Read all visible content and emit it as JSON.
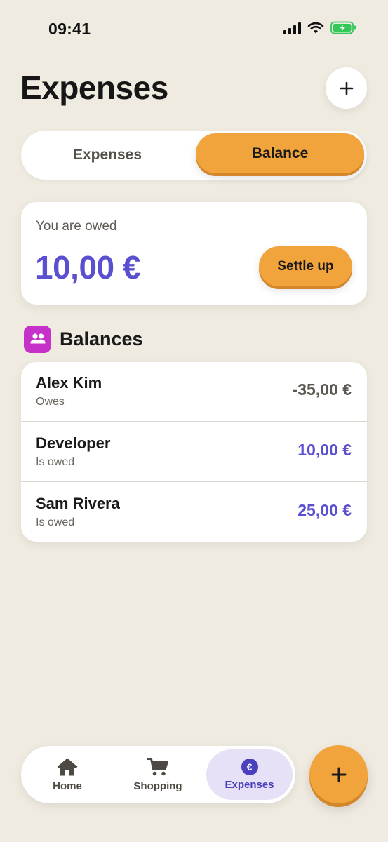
{
  "status_bar": {
    "time": "09:41",
    "icons": [
      "signal-icon",
      "wifi-icon",
      "battery-charging-icon"
    ],
    "battery_color": "#34C759"
  },
  "header": {
    "title": "Expenses",
    "add_icon": "plus-icon"
  },
  "segmented": {
    "options": [
      "Expenses",
      "Balance"
    ],
    "selected": "Balance"
  },
  "summary": {
    "label": "You are owed",
    "amount": "10,00 €",
    "settle_label": "Settle up"
  },
  "balances": {
    "title": "Balances",
    "icon": "people-icon",
    "rows": [
      {
        "name": "Alex Kim",
        "status": "Owes",
        "amount": "-35,00 €"
      },
      {
        "name": "Developer",
        "status": "Is owed",
        "amount": "10,00 €"
      },
      {
        "name": "Sam Rivera",
        "status": "Is owed",
        "amount": "25,00 €"
      }
    ]
  },
  "nav": {
    "items": [
      {
        "label": "Home",
        "icon": "home-icon"
      },
      {
        "label": "Shopping",
        "icon": "cart-icon"
      },
      {
        "label": "Expenses",
        "icon": "euro-icon",
        "glyph": "€"
      }
    ],
    "active": "Expenses",
    "fab_icon": "plus-icon"
  },
  "colors": {
    "background": "#EFEBE1",
    "accent_orange": "#F2A43C",
    "accent_purple": "#5A4FCF",
    "section_icon": "#C531C9"
  }
}
